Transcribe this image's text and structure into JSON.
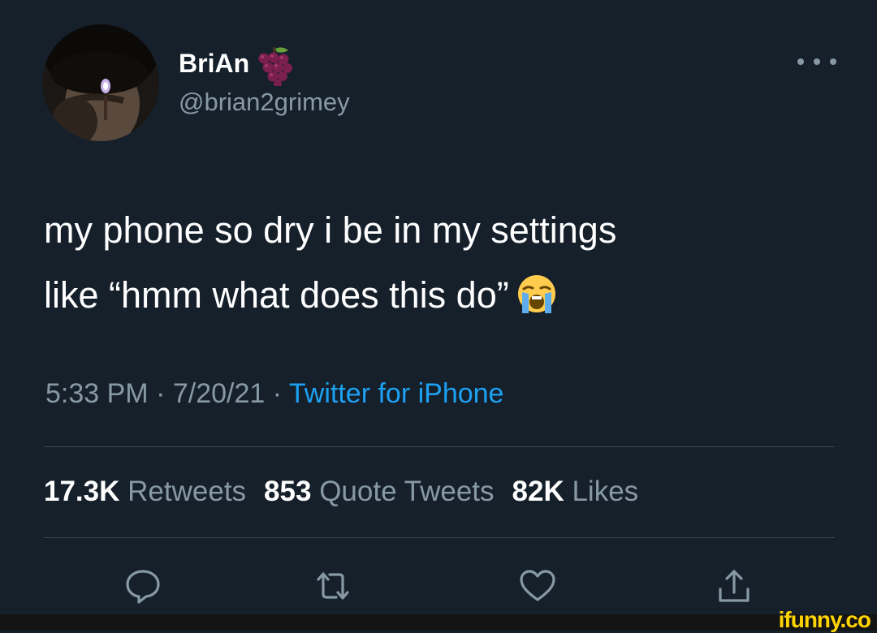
{
  "author": {
    "display_name": "BriAn",
    "handle": "@brian2grimey"
  },
  "tweet": {
    "line1": "my phone so dry i be in my settings",
    "line2": "like “hmm what does this do”",
    "emoji": "loudly-crying-face"
  },
  "meta": {
    "time": "5:33 PM",
    "separator1": " · ",
    "date": "7/20/21",
    "separator2": " · ",
    "source": "Twitter for iPhone"
  },
  "stats": {
    "retweets_count": "17.3K",
    "retweets_label": "Retweets",
    "quotes_count": "853",
    "quotes_label": "Quote Tweets",
    "likes_count": "82K",
    "likes_label": "Likes"
  },
  "actions": [
    "reply-icon",
    "retweet-icon",
    "like-icon",
    "share-icon"
  ],
  "watermark": "ifunny.co",
  "colors": {
    "background": "#15202b",
    "text": "#ffffff",
    "secondary": "#8899a6",
    "link": "#1da1f2",
    "divider": "#38444d",
    "watermark": "#ffd400"
  }
}
